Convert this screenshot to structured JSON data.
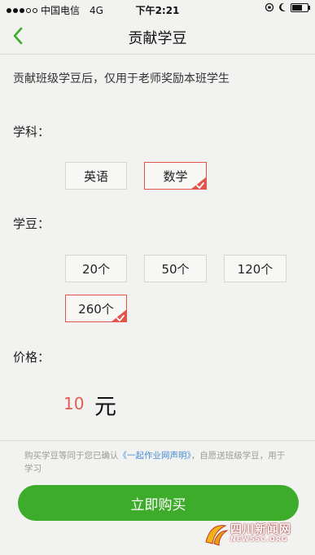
{
  "status_bar": {
    "carrier": "中国电信",
    "network": "4G",
    "time": "下午2:21"
  },
  "nav": {
    "title": "贡献学豆"
  },
  "notice": "贡献班级学豆后，仅用于老师奖励本班学生",
  "subject": {
    "label": "学科：",
    "options": [
      "英语",
      "数学"
    ],
    "selected": "数学"
  },
  "beans": {
    "label": "学豆：",
    "options": [
      "20个",
      "50个",
      "120个",
      "260个"
    ],
    "selected": "260个"
  },
  "price": {
    "label": "价格：",
    "value": "10",
    "unit": "元"
  },
  "disclaimer": {
    "before": "购买学豆等同于您已确认",
    "link": "《一起作业网声明》",
    "after": "，自愿送班级学豆，用于学习"
  },
  "buy_button": "立即购买",
  "watermark": {
    "text": "四川新闻网",
    "sub": "NEWSSC.ORG"
  },
  "colors": {
    "accent_green": "#3dac2a",
    "selected_red": "#e2554a",
    "link_blue": "#4a8fd6"
  }
}
